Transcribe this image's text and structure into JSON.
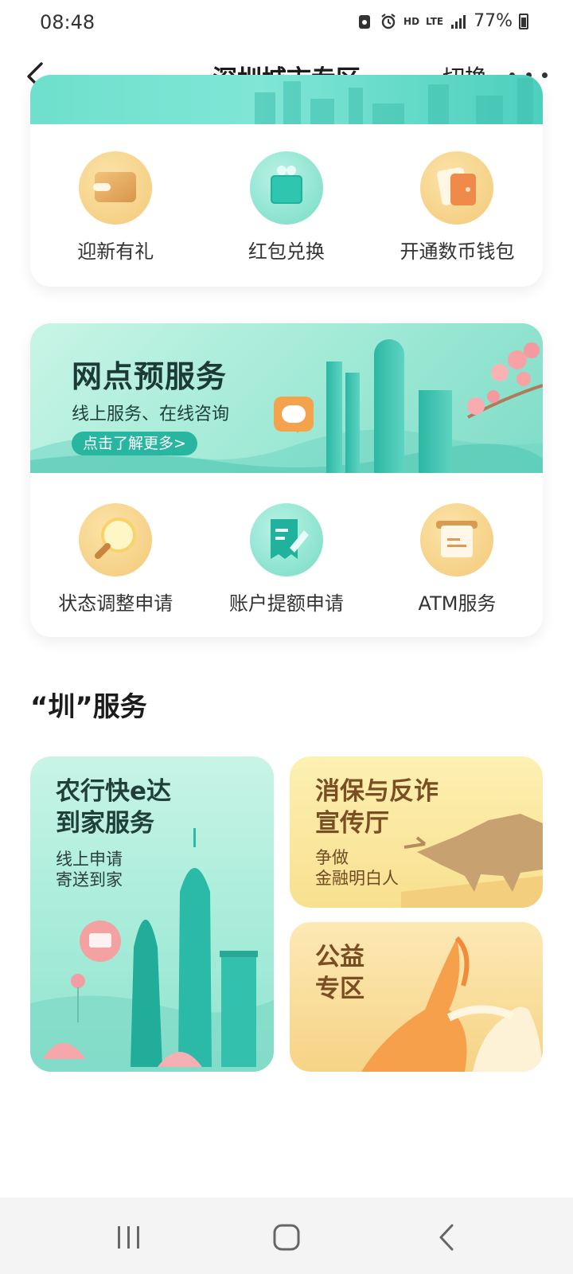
{
  "status_bar": {
    "time": "08:48",
    "network_hd": "HD",
    "network_lte": "LTE",
    "battery": "77%"
  },
  "nav": {
    "title": "深圳城市专区",
    "switch_label": "切换"
  },
  "quick_actions": [
    {
      "label": "迎新有礼",
      "icon": "wallet-icon"
    },
    {
      "label": "红包兑换",
      "icon": "gift-icon"
    },
    {
      "label": "开通数币钱包",
      "icon": "digital-wallet-icon"
    }
  ],
  "branch_banner": {
    "title": "网点预服务",
    "subtitle": "线上服务、在线咨询",
    "button": "点击了解更多>"
  },
  "branch_actions": [
    {
      "label": "状态调整申请",
      "icon": "magnifier-icon"
    },
    {
      "label": "账户提额申请",
      "icon": "document-edit-icon"
    },
    {
      "label": "ATM服务",
      "icon": "atm-icon"
    }
  ],
  "section": {
    "title": "“圳”服务"
  },
  "tiles": {
    "delivery": {
      "title_line1": "农行快e达",
      "title_line2": "到家服务",
      "sub_line1": "线上申请",
      "sub_line2": "寄送到家"
    },
    "anti_fraud": {
      "title_line1": "消保与反诈",
      "title_line2": "宣传厅",
      "sub_line1": "争做",
      "sub_line2": "金融明白人"
    },
    "charity": {
      "title_line1": "公益",
      "title_line2": "专区"
    }
  },
  "colors": {
    "teal_accent": "#29b6a0",
    "gold_accent": "#f3c979",
    "brown_text": "#7a4e22"
  }
}
